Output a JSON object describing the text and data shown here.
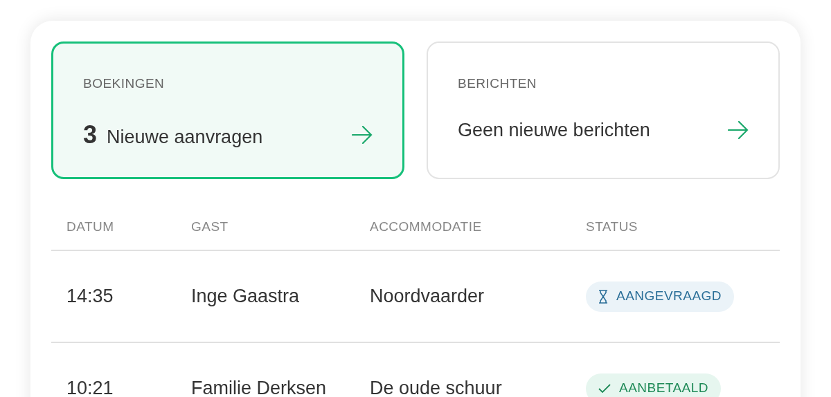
{
  "cards": [
    {
      "label": "BOEKINGEN",
      "count": "3",
      "text": "Nieuwe aanvragen",
      "selected": true
    },
    {
      "label": "BERICHTEN",
      "text": "Geen nieuwe berichten",
      "selected": false
    }
  ],
  "table": {
    "columns": [
      "DATUM",
      "GAST",
      "ACCOMMODATIE",
      "STATUS"
    ],
    "rows": [
      {
        "time": "14:35",
        "guest": "Inge Gaastra",
        "accommodation": "Noordvaarder",
        "status": {
          "kind": "requested",
          "label": "AANGEVRAAGD"
        }
      },
      {
        "time": "10:21",
        "guest": "Familie Derksen",
        "accommodation": "De oude schuur",
        "status": {
          "kind": "paid",
          "label": "AANBETAALD"
        }
      }
    ]
  }
}
